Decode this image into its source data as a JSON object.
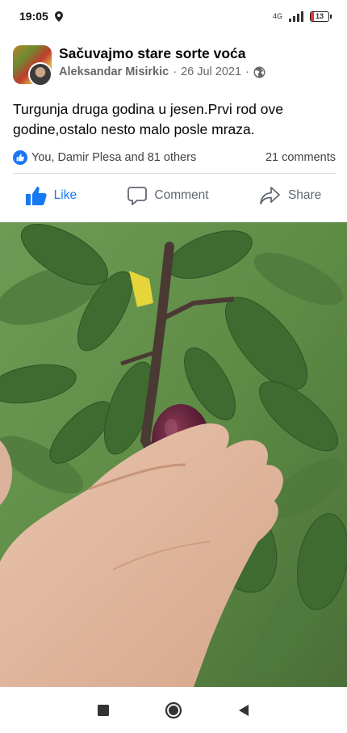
{
  "status_bar": {
    "time": "19:05",
    "network": "4G",
    "battery": "13"
  },
  "post": {
    "group_name": "Sačuvajmo stare sorte voća",
    "author": "Aleksandar Misirkic",
    "date": "26 Jul 2021",
    "separator": "·",
    "text": "Turgunja druga godina u jesen.Prvi rod ove godine,ostalo nesto malo posle mraza.",
    "reactions_text": "You, Damir Plesa and 81 others",
    "comments_count": "21 comments"
  },
  "actions": {
    "like": "Like",
    "comment": "Comment",
    "share": "Share"
  },
  "colors": {
    "accent": "#1877f2",
    "secondary_text": "#65676b",
    "battery_low": "#e53935"
  },
  "icons": {
    "status_location": "location-pin-icon",
    "status_signal": "signal-icon",
    "status_battery": "battery-icon",
    "privacy": "globe-icon",
    "reaction": "like-reaction-icon",
    "like": "thumbs-up-icon",
    "comment": "comment-bubble-icon",
    "share": "share-arrow-icon",
    "nav_recents": "square-recents-icon",
    "nav_home": "circle-home-icon",
    "nav_back": "triangle-back-icon"
  }
}
